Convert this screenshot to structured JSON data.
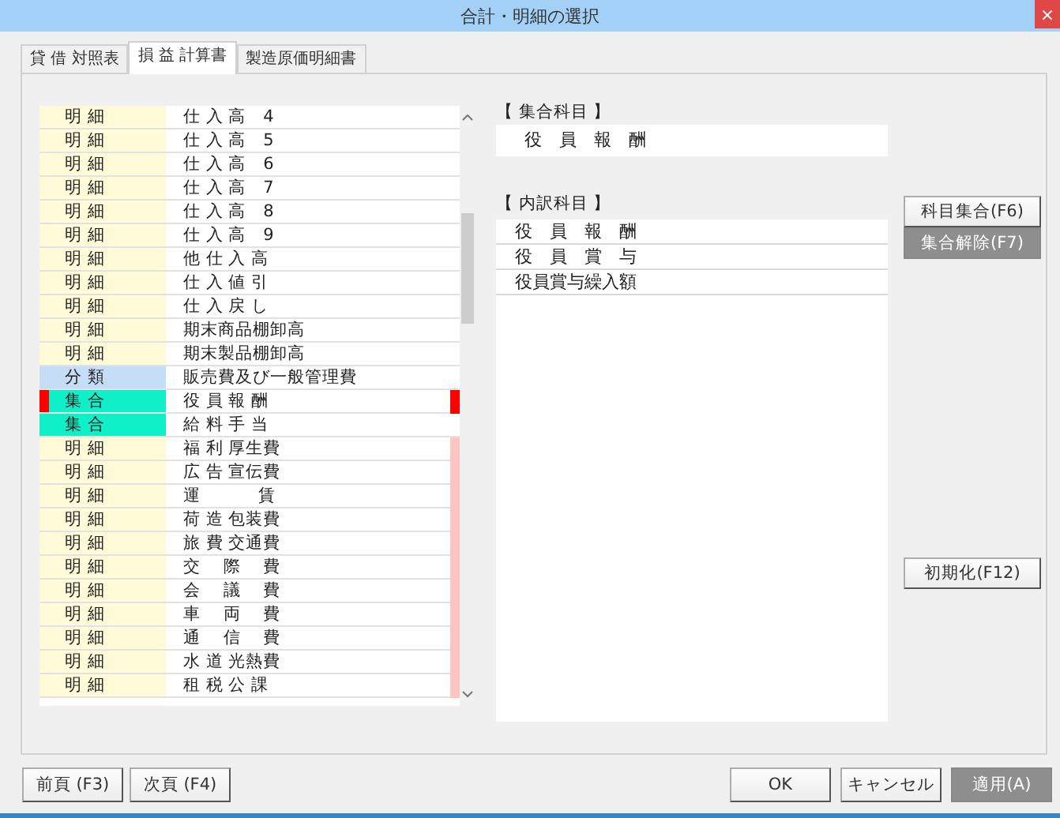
{
  "window": {
    "title": "合計・明細の選択",
    "close": "×"
  },
  "tabs": [
    {
      "label": "貸 借 対照表",
      "selected": false
    },
    {
      "label": "損 益 計算書",
      "selected": true
    },
    {
      "label": "製造原価明細書",
      "selected": false
    }
  ],
  "accounts": [
    {
      "kind": "detail",
      "type_label": "明 細",
      "name": "仕 入 高　4",
      "selected": false,
      "marked": false
    },
    {
      "kind": "detail",
      "type_label": "明 細",
      "name": "仕 入 高　5",
      "selected": false,
      "marked": false
    },
    {
      "kind": "detail",
      "type_label": "明 細",
      "name": "仕 入 高　6",
      "selected": false,
      "marked": false
    },
    {
      "kind": "detail",
      "type_label": "明 細",
      "name": "仕 入 高　7",
      "selected": false,
      "marked": false
    },
    {
      "kind": "detail",
      "type_label": "明 細",
      "name": "仕 入 高　8",
      "selected": false,
      "marked": false
    },
    {
      "kind": "detail",
      "type_label": "明 細",
      "name": "仕 入 高　9",
      "selected": false,
      "marked": false
    },
    {
      "kind": "detail",
      "type_label": "明 細",
      "name": "他 仕 入 高",
      "selected": false,
      "marked": false
    },
    {
      "kind": "detail",
      "type_label": "明 細",
      "name": "仕 入 値 引",
      "selected": false,
      "marked": false
    },
    {
      "kind": "detail",
      "type_label": "明 細",
      "name": "仕 入 戻 し",
      "selected": false,
      "marked": false
    },
    {
      "kind": "detail",
      "type_label": "明 細",
      "name": "期末商品棚卸高",
      "selected": false,
      "marked": false
    },
    {
      "kind": "detail",
      "type_label": "明 細",
      "name": "期末製品棚卸高",
      "selected": false,
      "marked": false
    },
    {
      "kind": "category",
      "type_label": "分 類",
      "name": "販売費及び一般管理費",
      "selected": false,
      "marked": false
    },
    {
      "kind": "group",
      "type_label": "集 合",
      "name": "役 員 報 酬",
      "selected": true,
      "marked": false
    },
    {
      "kind": "group",
      "type_label": "集 合",
      "name": "給 料 手 当",
      "selected": false,
      "marked": false
    },
    {
      "kind": "detail",
      "type_label": "明 細",
      "name": "福 利 厚生費",
      "selected": false,
      "marked": true
    },
    {
      "kind": "detail",
      "type_label": "明 細",
      "name": "広 告 宣伝費",
      "selected": false,
      "marked": true
    },
    {
      "kind": "detail",
      "type_label": "明 細",
      "name": "運　　　 賃",
      "selected": false,
      "marked": true
    },
    {
      "kind": "detail",
      "type_label": "明 細",
      "name": "荷 造 包装費",
      "selected": false,
      "marked": true
    },
    {
      "kind": "detail",
      "type_label": "明 細",
      "name": "旅 費 交通費",
      "selected": false,
      "marked": true
    },
    {
      "kind": "detail",
      "type_label": "明 細",
      "name": "交　 際　 費",
      "selected": false,
      "marked": true
    },
    {
      "kind": "detail",
      "type_label": "明 細",
      "name": "会　 議　 費",
      "selected": false,
      "marked": true
    },
    {
      "kind": "detail",
      "type_label": "明 細",
      "name": "車　 両　 費",
      "selected": false,
      "marked": true
    },
    {
      "kind": "detail",
      "type_label": "明 細",
      "name": "通　 信　 費",
      "selected": false,
      "marked": true
    },
    {
      "kind": "detail",
      "type_label": "明 細",
      "name": "水 道 光熱費",
      "selected": false,
      "marked": true
    },
    {
      "kind": "detail",
      "type_label": "明 細",
      "name": "租 税 公 課",
      "selected": false,
      "marked": true
    }
  ],
  "group_account": {
    "label": "【 集合科目 】",
    "value": "役　員　報　酬"
  },
  "breakdown": {
    "label": "【 内訳科目 】",
    "items": [
      "役　員　報　酬",
      "役　員　賞　与",
      "役員賞与繰入額"
    ]
  },
  "side_buttons": [
    {
      "label": "科目集合(F6)",
      "disabled": false
    },
    {
      "label": "集合解除(F7)",
      "disabled": true
    }
  ],
  "reset_button": {
    "label": "初期化(F12)",
    "disabled": false
  },
  "page_buttons": [
    {
      "label": "前頁 (F3)"
    },
    {
      "label": "次頁 (F4)"
    }
  ],
  "dialog_buttons": [
    {
      "label": "OK",
      "disabled": false
    },
    {
      "label": "キャンセル",
      "disabled": false
    },
    {
      "label": "適用(A)",
      "disabled": true
    }
  ]
}
